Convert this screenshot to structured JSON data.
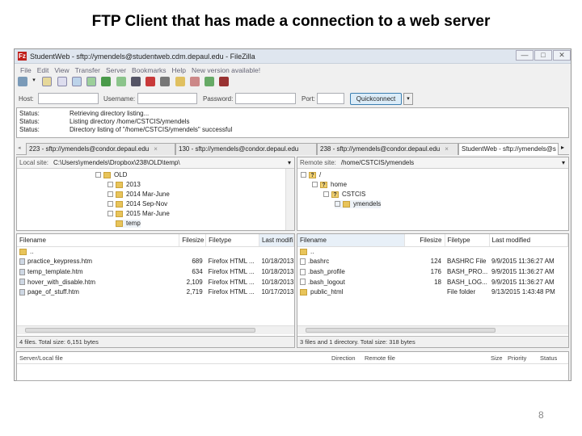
{
  "slide": {
    "title": "FTP Client that has made a connection to a web server",
    "page_number": "8"
  },
  "window": {
    "title": "StudentWeb - sftp://ymendels@studentweb.cdm.depaul.edu - FileZilla",
    "app_icon_letter": "Fz",
    "controls": {
      "minimize": "—",
      "maximize": "□",
      "close": "✕"
    },
    "menu": [
      "File",
      "Edit",
      "View",
      "Transfer",
      "Server",
      "Bookmarks",
      "Help",
      "New version available!"
    ]
  },
  "quickconnect": {
    "host_label": "Host:",
    "host_value": "",
    "username_label": "Username:",
    "username_value": "",
    "password_label": "Password:",
    "password_value": "",
    "port_label": "Port:",
    "port_value": "",
    "button": "Quickconnect",
    "dropdown": "▾"
  },
  "log": [
    {
      "label": "Status:",
      "text": "Retrieving directory listing..."
    },
    {
      "label": "Status:",
      "text": "Listing directory /home/CSTCIS/ymendels"
    },
    {
      "label": "Status:",
      "text": "Directory listing of \"/home/CSTCIS/ymendels\" successful"
    }
  ],
  "tabs": [
    {
      "label": "223 - sftp://ymendels@condor.depaul.edu"
    },
    {
      "label": "130 - sftp://ymendels@condor.depaul.edu"
    },
    {
      "label": "238 - sftp://ymendels@condor.depaul.edu"
    },
    {
      "label": "StudentWeb - sftp://ymendels@s"
    }
  ],
  "local": {
    "site_label": "Local site:",
    "path": "C:\\Users\\ymendels\\Dropbox\\238\\OLD\\temp\\",
    "tree": [
      "OLD",
      "2013",
      "2014 Mar-June",
      "2014 Sep-Nov",
      "2015 Mar-June",
      "temp"
    ],
    "columns": [
      "Filename",
      "Filesize",
      "Filetype",
      "Last modifi"
    ],
    "files": [
      {
        "name": "..",
        "size": "",
        "type": "",
        "modified": ""
      },
      {
        "name": "practice_keypress.htm",
        "size": "689",
        "type": "Firefox HTML ...",
        "modified": "10/18/2013"
      },
      {
        "name": "temp_template.htm",
        "size": "634",
        "type": "Firefox HTML ...",
        "modified": "10/18/2013"
      },
      {
        "name": "hover_with_disable.htm",
        "size": "2,109",
        "type": "Firefox HTML ...",
        "modified": "10/18/2013"
      },
      {
        "name": "page_of_stuff.htm",
        "size": "2,719",
        "type": "Firefox HTML ...",
        "modified": "10/17/2013"
      }
    ],
    "status": "4 files. Total size: 6,151 bytes"
  },
  "remote": {
    "site_label": "Remote site:",
    "path": "/home/CSTCIS/ymendels",
    "tree": [
      "/",
      "home",
      "CSTCIS",
      "ymendels"
    ],
    "columns": [
      "Filename",
      "Filesize",
      "Filetype",
      "Last modified"
    ],
    "files": [
      {
        "name": "..",
        "size": "",
        "type": "",
        "modified": ""
      },
      {
        "name": ".bashrc",
        "size": "124",
        "type": "BASHRC File",
        "modified": "9/9/2015 11:36:27 AM"
      },
      {
        "name": ".bash_profile",
        "size": "176",
        "type": "BASH_PRO...",
        "modified": "9/9/2015 11:36:27 AM"
      },
      {
        "name": ".bash_logout",
        "size": "18",
        "type": "BASH_LOG...",
        "modified": "9/9/2015 11:36:27 AM"
      },
      {
        "name": "public_html",
        "size": "",
        "type": "File folder",
        "modified": "9/13/2015 1:43:48 PM"
      }
    ],
    "status": "3 files and 1 directory. Total size: 318 bytes"
  },
  "queue": {
    "columns": [
      "Server/Local file",
      "Direction",
      "Remote file",
      "Size",
      "Priority",
      "Status"
    ]
  }
}
